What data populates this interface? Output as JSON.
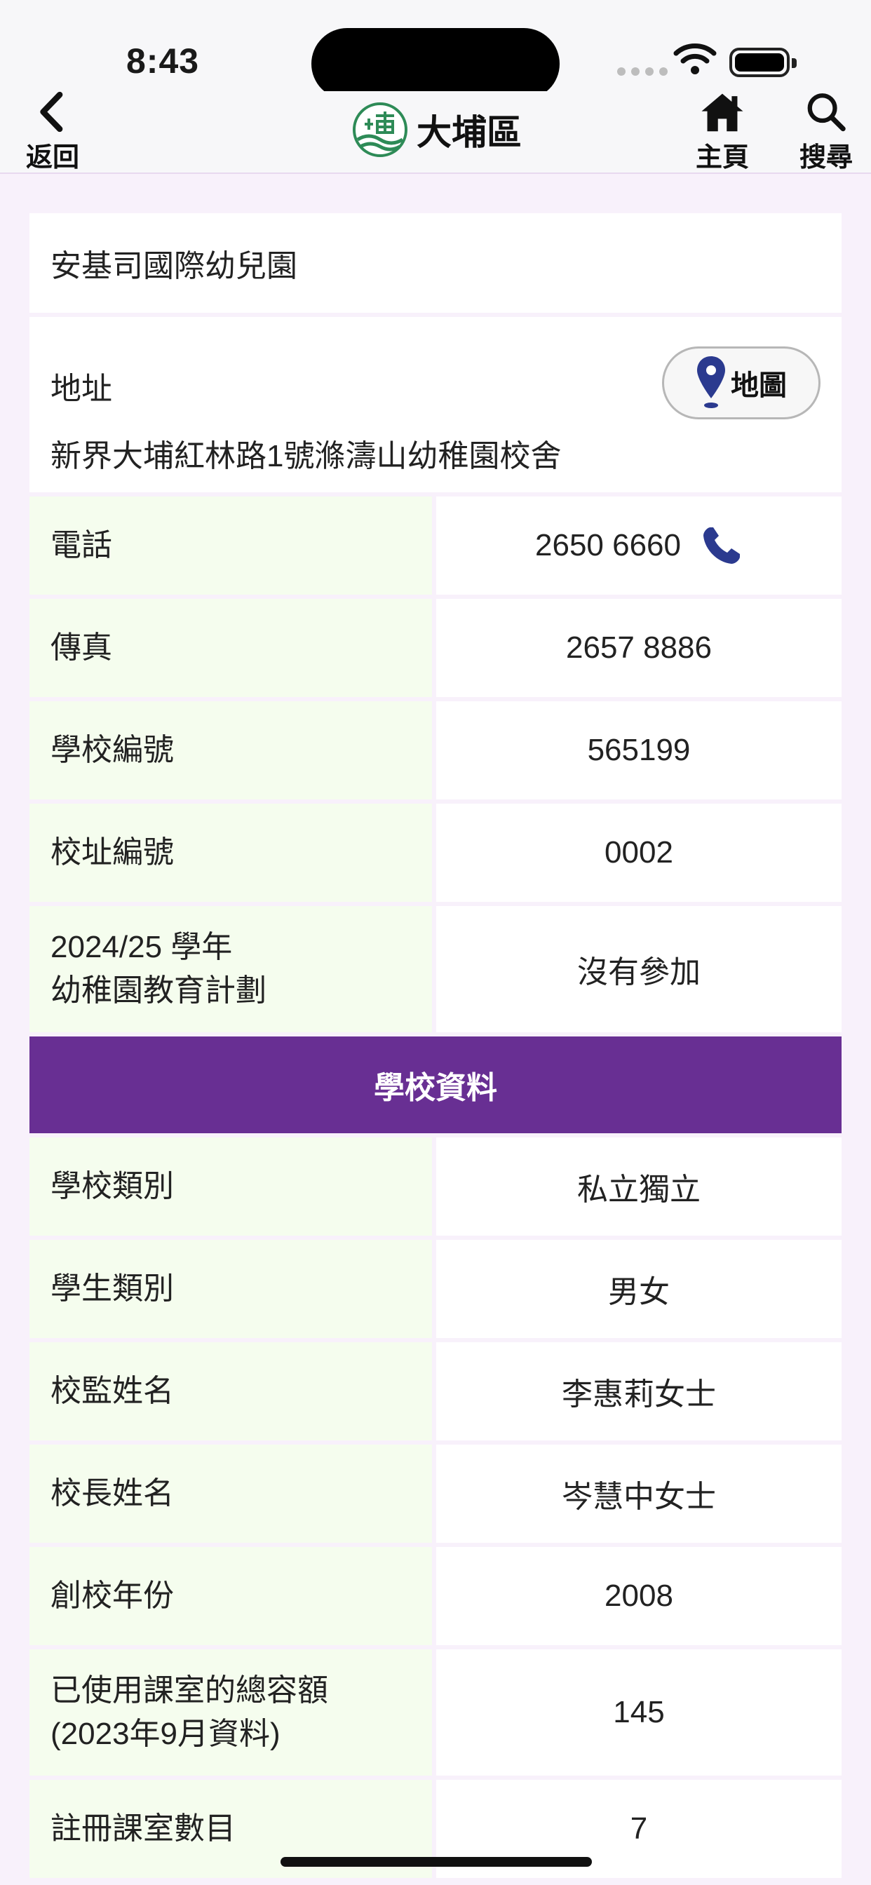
{
  "status_bar": {
    "time": "8:43"
  },
  "nav": {
    "back_label": "返回",
    "title": "大埔區",
    "home_label": "主頁",
    "search_label": "搜尋"
  },
  "school": {
    "name": "安基司國際幼兒園",
    "address_label": "地址",
    "address_value": "新界大埔紅林路1號滌濤山幼稚園校舍",
    "map_label": "地圖"
  },
  "contact_rows": [
    {
      "key": "電話",
      "value": "2650 6660"
    },
    {
      "key": "傳真",
      "value": "2657 8886"
    },
    {
      "key": "學校編號",
      "value": "565199"
    },
    {
      "key": "校址編號",
      "value": "0002"
    }
  ],
  "scheme_row": {
    "key_line1": "2024/25 學年",
    "key_line2": "幼稚園教育計劃",
    "value": "沒有參加"
  },
  "section_title": "學校資料",
  "info_rows": [
    {
      "key": "學校類別",
      "value": "私立獨立"
    },
    {
      "key": "學生類別",
      "value": "男女"
    },
    {
      "key": "校監姓名",
      "value": "李惠莉女士"
    },
    {
      "key": "校長姓名",
      "value": "岑慧中女士"
    },
    {
      "key": "創校年份",
      "value": "2008"
    }
  ],
  "capacity_row": {
    "key_line1": "已使用課室的總容額",
    "key_line2": "(2023年9月資料)",
    "value": "145"
  },
  "classroom_row": {
    "key": "註冊課室數目",
    "value": "7"
  },
  "colors": {
    "accent": "#682f93",
    "label_bg": "#f5fdee",
    "page_bg": "#f8f1fb",
    "icon_blue": "#2b3a8f",
    "logo_green": "#2e8b57"
  },
  "icons": [
    "chevron-left-icon",
    "logo-icon",
    "home-icon",
    "search-icon",
    "map-pin-icon",
    "phone-icon",
    "wifi-icon",
    "battery-icon"
  ]
}
